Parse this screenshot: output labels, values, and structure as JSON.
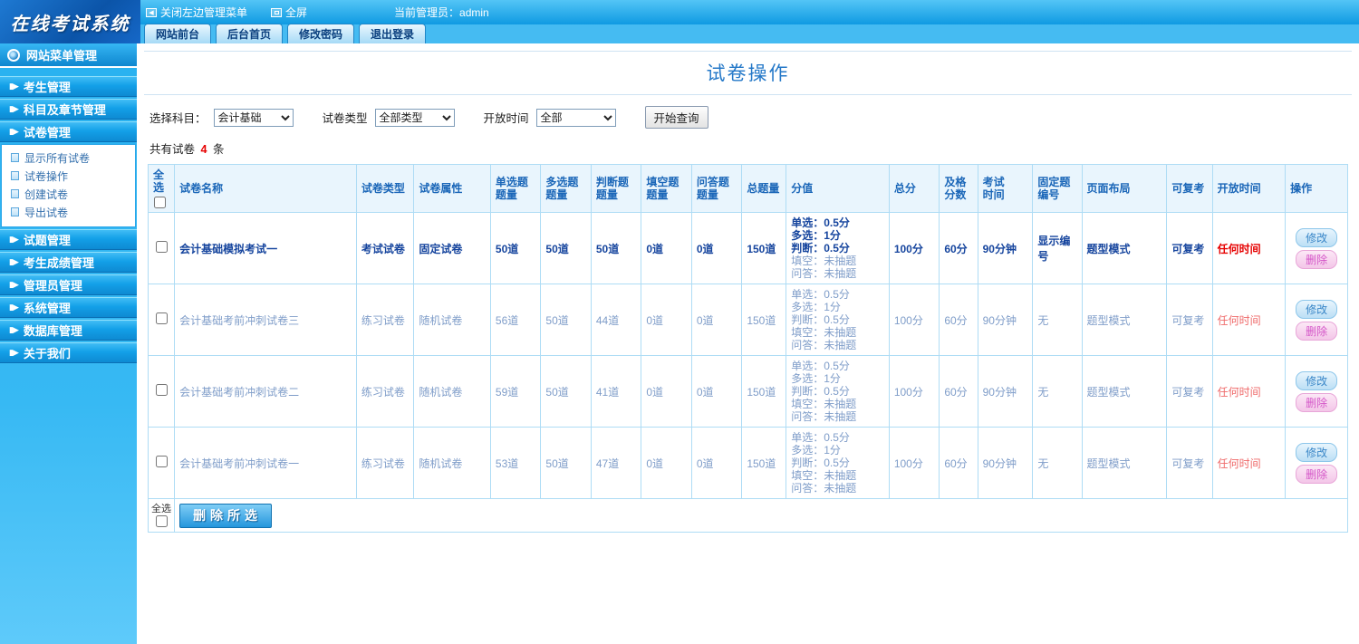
{
  "app": {
    "logo": "在线考试系统"
  },
  "topbar": {
    "close_menu": "关闭左边管理菜单",
    "fullscreen": "全屏",
    "admin": "当前管理员：admin",
    "tabs": [
      "网站前台",
      "后台首页",
      "修改密码",
      "退出登录"
    ]
  },
  "sidebar": {
    "title": "网站菜单管理",
    "items": [
      {
        "label": "考生管理"
      },
      {
        "label": "科目及章节管理"
      },
      {
        "label": "试卷管理",
        "children": [
          "显示所有试卷",
          "试卷操作",
          "创建试卷",
          "导出试卷"
        ]
      },
      {
        "label": "试题管理"
      },
      {
        "label": "考生成绩管理"
      },
      {
        "label": "管理员管理"
      },
      {
        "label": "系统管理"
      },
      {
        "label": "数据库管理"
      },
      {
        "label": "关于我们"
      }
    ]
  },
  "main": {
    "title": "试卷操作",
    "filters": {
      "subject_label": "选择科目：",
      "subject_value": "会计基础",
      "type_label": "试卷类型",
      "type_value": "全部类型",
      "open_label": "开放时间",
      "open_value": "全部",
      "query_button": "开始查询"
    },
    "summary": {
      "prefix": "共有试卷",
      "count": "4",
      "suffix": "条"
    },
    "table": {
      "headers": [
        "全选",
        "试卷名称",
        "试卷类型",
        "试卷属性",
        "单选题\n题量",
        "多选题\n题量",
        "判断题\n题量",
        "填空题\n题量",
        "问答题\n题量",
        "总题量",
        "分值",
        "总分",
        "及格\n分数",
        "考试\n时间",
        "固定题\n编号",
        "页面布局",
        "可复考",
        "开放时间",
        "操作"
      ],
      "actions": {
        "edit": "修改",
        "delete": "删除"
      },
      "rows": [
        {
          "strong": true,
          "name": "会计基础模拟考试一",
          "type": "考试试卷",
          "attr": "固定试卷",
          "single": "50道",
          "multi": "50道",
          "judge": "50道",
          "fill": "0道",
          "essay": "0道",
          "total_q": "150道",
          "score": [
            "单选：0.5分",
            "多选：1分",
            "判断：0.5分",
            "填空：未抽题",
            "问答：未抽题"
          ],
          "total_score": "100分",
          "pass_score": "60分",
          "duration": "90分钟",
          "fixed_no": "显示编号",
          "layout": "题型模式",
          "recheck": "可复考",
          "open_time": "任何时间"
        },
        {
          "strong": false,
          "name": "会计基础考前冲刺试卷三",
          "type": "练习试卷",
          "attr": "随机试卷",
          "single": "56道",
          "multi": "50道",
          "judge": "44道",
          "fill": "0道",
          "essay": "0道",
          "total_q": "150道",
          "score": [
            "单选：0.5分",
            "多选：1分",
            "判断：0.5分",
            "填空：未抽题",
            "问答：未抽题"
          ],
          "total_score": "100分",
          "pass_score": "60分",
          "duration": "90分钟",
          "fixed_no": "无",
          "layout": "题型模式",
          "recheck": "可复考",
          "open_time": "任何时间"
        },
        {
          "strong": false,
          "name": "会计基础考前冲刺试卷二",
          "type": "练习试卷",
          "attr": "随机试卷",
          "single": "59道",
          "multi": "50道",
          "judge": "41道",
          "fill": "0道",
          "essay": "0道",
          "total_q": "150道",
          "score": [
            "单选：0.5分",
            "多选：1分",
            "判断：0.5分",
            "填空：未抽题",
            "问答：未抽题"
          ],
          "total_score": "100分",
          "pass_score": "60分",
          "duration": "90分钟",
          "fixed_no": "无",
          "layout": "题型模式",
          "recheck": "可复考",
          "open_time": "任何时间"
        },
        {
          "strong": false,
          "name": "会计基础考前冲刺试卷一",
          "type": "练习试卷",
          "attr": "随机试卷",
          "single": "53道",
          "multi": "50道",
          "judge": "47道",
          "fill": "0道",
          "essay": "0道",
          "total_q": "150道",
          "score": [
            "单选：0.5分",
            "多选：1分",
            "判断：0.5分",
            "填空：未抽题",
            "问答：未抽题"
          ],
          "total_score": "100分",
          "pass_score": "60分",
          "duration": "90分钟",
          "fixed_no": "无",
          "layout": "题型模式",
          "recheck": "可复考",
          "open_time": "任何时间"
        }
      ]
    },
    "footer": {
      "select_all": "全选",
      "delete_selected": "删除所选"
    }
  }
}
